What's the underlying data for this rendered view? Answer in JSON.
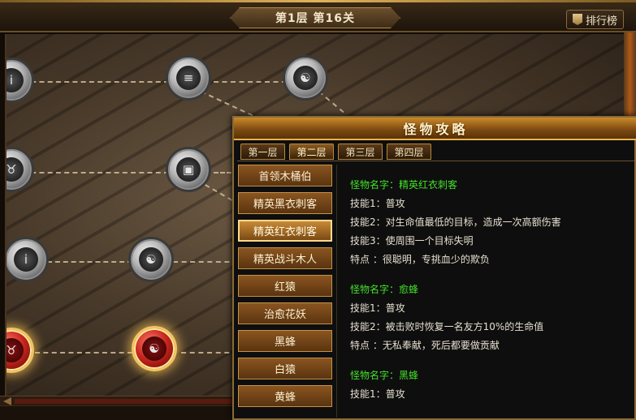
{
  "header": {
    "level_label": "第1层 第16关",
    "rank_button": "排行榜",
    "rank_icon": "banner-icon"
  },
  "map": {
    "nodes": [
      {
        "name": "info-scroll-node",
        "glyph": "i",
        "state": "locked"
      },
      {
        "name": "scroll-node",
        "glyph": "≡",
        "state": "locked"
      },
      {
        "name": "dragon-node",
        "glyph": "☯",
        "state": "locked"
      },
      {
        "name": "bull-node",
        "glyph": "♉",
        "state": "locked"
      },
      {
        "name": "chest-node",
        "glyph": "▣",
        "state": "locked"
      },
      {
        "name": "book-node",
        "glyph": "i",
        "state": "locked"
      },
      {
        "name": "dragon-node",
        "glyph": "☯",
        "state": "locked"
      },
      {
        "name": "bull-node-active",
        "glyph": "♉",
        "state": "active"
      },
      {
        "name": "dragon-node-current",
        "glyph": "☯",
        "state": "current"
      }
    ]
  },
  "panel": {
    "title": "怪物攻略",
    "tabs": [
      "第一层",
      "第二层",
      "第三层",
      "第四层"
    ],
    "active_tab": 1,
    "monsters": [
      "首领木桶伯",
      "精英黑衣刺客",
      "精英红衣刺客",
      "精英战斗木人",
      "红猿",
      "治愈花妖",
      "黑蜂",
      "白猿",
      "黄蜂"
    ],
    "active_monster": 2,
    "details": [
      {
        "name": "怪物名字：精英红衣刺客",
        "lines": [
          "技能1：普攻",
          "技能2：对生命值最低的目标，造成一次高额伤害",
          "技能3：使周围一个目标失明",
          "特点 ：很聪明，专挑血少的欺负"
        ]
      },
      {
        "name": "怪物名字：愈蜂",
        "lines": [
          "技能1：普攻",
          "技能2：被击败时恢复一名友方10%的生命值",
          "特点 ：无私奉献，死后都要做贡献"
        ]
      },
      {
        "name": "怪物名字：黑蜂",
        "lines": [
          "技能1：普攻"
        ]
      }
    ]
  },
  "colors": {
    "gold": "#e8b24a",
    "monster_name_green": "#44e02a",
    "active_node_red": "#c8261d"
  }
}
